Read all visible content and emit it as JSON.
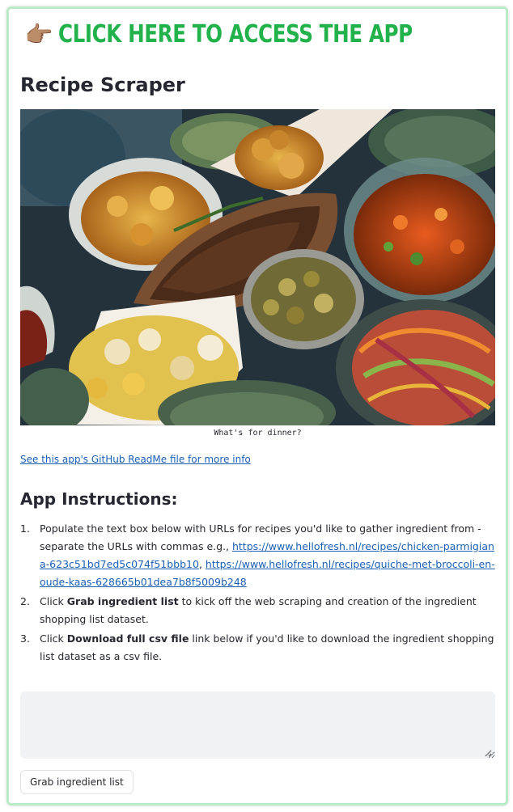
{
  "banner": {
    "emoji": "👉🏽",
    "text": "CLICK HERE TO ACCESS THE APP"
  },
  "page": {
    "title": "Recipe Scraper",
    "image_caption": "What's for dinner?",
    "readme_link": "See this app's GitHub ReadMe file for more info"
  },
  "instructions": {
    "title": "App Instructions:",
    "step1": {
      "num": "1.",
      "text": "Populate the text box below with URLs for recipes you'd like to gather ingredient from - separate the URLs with commas e.g., ",
      "url1": "https://www.hellofresh.nl/recipes/chicken-parmigiana-623c51bd7ed5c074f51bbb10",
      "sep": ", ",
      "url2": "https://www.hellofresh.nl/recipes/quiche-met-broccoli-en-oude-kaas-628665b01dea7b8f5009b248"
    },
    "step2": {
      "num": "2.",
      "pre": "Click ",
      "bold": "Grab ingredient list",
      "post": " to kick off the web scraping and creation of the ingredient shopping list dataset."
    },
    "step3": {
      "num": "3.",
      "pre": "Click ",
      "bold": "Download full csv file",
      "post": " link below if you'd like to download the ingredient shopping list dataset as a csv file."
    }
  },
  "form": {
    "textarea_value": "",
    "button_label": "Grab ingredient list"
  },
  "colors": {
    "banner_green": "#21b24b",
    "frame_border": "#b9ecc6",
    "link_blue": "#1a5fb4",
    "input_bg": "#f0f2f6"
  }
}
